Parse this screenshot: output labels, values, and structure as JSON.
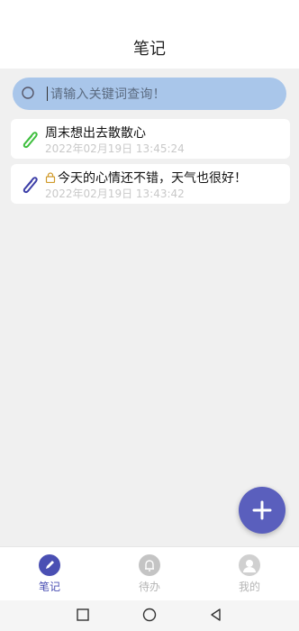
{
  "header": {
    "title": "笔记"
  },
  "search": {
    "placeholder": "请输入关键词查询！",
    "icon": "search-icon"
  },
  "notes": [
    {
      "title": "周末想出去散散心",
      "date": "2022年02月19日 13:45:24",
      "locked": false,
      "clip_color": "#3fbf3f"
    },
    {
      "title": "今天的心情还不错，天气也很好！",
      "date": "2022年02月19日 13:43:42",
      "locked": true,
      "clip_color": "#3d3fa8"
    }
  ],
  "fab": {
    "icon": "plus-icon",
    "color": "#5a5fbd"
  },
  "tabs": [
    {
      "label": "笔记",
      "icon": "pencil-icon",
      "active": true
    },
    {
      "label": "待办",
      "icon": "bell-icon",
      "active": false
    },
    {
      "label": "我的",
      "icon": "user-icon",
      "active": false
    }
  ],
  "colors": {
    "active": "#4a4fb3",
    "inactive": "#b5b5b5"
  }
}
